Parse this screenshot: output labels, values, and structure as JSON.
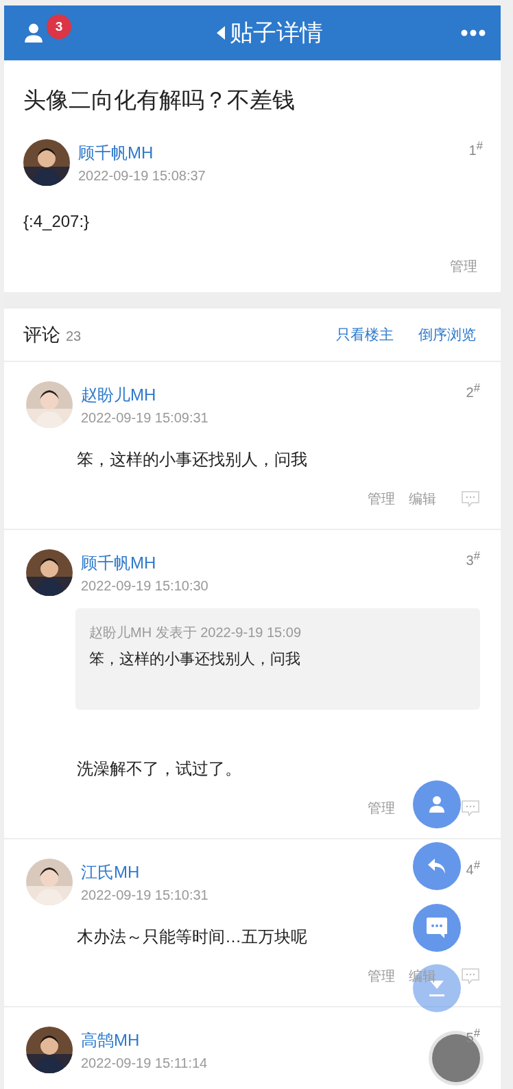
{
  "header": {
    "badge": "3",
    "title": "贴子详情"
  },
  "post": {
    "title": "头像二向化有解吗？不差钱",
    "author": "顾千帆MH",
    "time": "2022-09-19 15:08:37",
    "floor": "1$^{#}$",
    "content": "{:4_207:}",
    "actions": [
      "管理"
    ]
  },
  "comments_header": {
    "label": "评论",
    "count": "23",
    "links": [
      "只看楼主",
      "倒序浏览"
    ]
  },
  "comments": [
    {
      "author": "赵盼儿MH",
      "time": "2022-09-19 15:09:31",
      "floor": "2$^{#}$",
      "content": "笨，这样的小事还找别人，问我",
      "actions": [
        "管理",
        "编辑"
      ]
    },
    {
      "author": "顾千帆MH",
      "time": "2022-09-19 15:10:30",
      "floor": "3$^{#}$",
      "quote": {
        "meta": "赵盼儿MH 发表于 2022-9-19 15:09",
        "text": "笨，这样的小事还找别人，问我"
      },
      "content": "洗澡解不了，试过了。",
      "actions": [
        "管理"
      ]
    },
    {
      "author": "江氏MH",
      "time": "2022-09-19 15:10:31",
      "floor": "4$^{#}$",
      "content": "木办法～只能等时间…五万块呢",
      "actions": [
        "管理",
        "编辑"
      ]
    },
    {
      "author": "高鹄MH",
      "time": "2022-09-19 15:11:14",
      "floor": "5$^{#}$"
    }
  ],
  "floating_buttons": [
    {
      "kind": "person"
    },
    {
      "kind": "reply"
    },
    {
      "kind": "chat"
    },
    {
      "kind": "download"
    },
    {
      "kind": "touch"
    }
  ]
}
